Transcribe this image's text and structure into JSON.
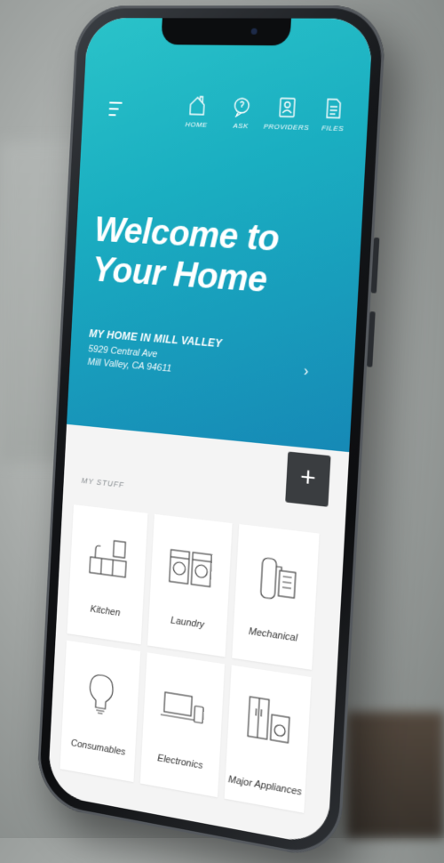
{
  "nav": {
    "items": [
      {
        "label": "HOME",
        "icon": "home-icon"
      },
      {
        "label": "ASK",
        "icon": "chat-icon"
      },
      {
        "label": "PROVIDERS",
        "icon": "providers-icon"
      },
      {
        "label": "FILES",
        "icon": "files-icon"
      }
    ]
  },
  "hero": {
    "title_line1": "Welcome to",
    "title_line2": "Your Home",
    "accent_color": "#1aaec1"
  },
  "address": {
    "name": "MY HOME IN MILL VALLEY",
    "street": "5929 Central Ave",
    "city": "Mill Valley, CA 94611",
    "chevron": "›"
  },
  "add_button": {
    "label": "+"
  },
  "stuff": {
    "title": "MY STUFF",
    "categories": [
      {
        "label": "Kitchen",
        "icon": "kitchen-icon"
      },
      {
        "label": "Laundry",
        "icon": "laundry-icon"
      },
      {
        "label": "Mechanical",
        "icon": "water-heater-icon"
      },
      {
        "label": "Consumables",
        "icon": "lightbulb-icon"
      },
      {
        "label": "Electronics",
        "icon": "laptop-icon"
      },
      {
        "label": "Major Appliances",
        "icon": "fridge-icon"
      }
    ]
  }
}
